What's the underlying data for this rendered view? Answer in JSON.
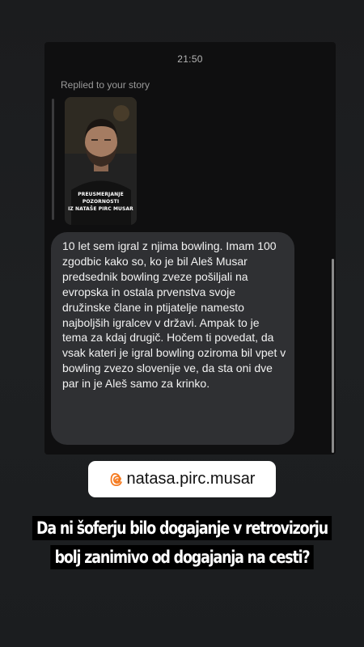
{
  "dm": {
    "time": "21:50",
    "replied_label": "Replied to your story",
    "story_caption_line1": "PREUSMERJANJE POZORNOSTI",
    "story_caption_line2": "IZ NATAŠE PIRC MUSAR",
    "message": "10 let sem igral z njima bowling. Imam 100 zgodbic kako so, ko je bil Aleš Musar predsednik bowling zveze pošiljali na evropska in ostala prvenstva svoje družinske člane in ptijatelje namesto najboljših igralcev v državi. Ampak to je tema za kdaj drugič. Hočem ti povedat, da vsak kateri je igral bowling oziroma bil vpet v bowling zvezo slovenije ve, da sta oni dve par in je Aleš samo za krinko."
  },
  "mention": {
    "icon": "threads-icon",
    "handle": "natasa.pirc.musar",
    "accent": "#f57a1f"
  },
  "headline": {
    "line1": "Da ni šoferju bilo dogajanje v retrovizorju",
    "line2": "bolj zanimivo od dogajanja na cesti?"
  },
  "colors": {
    "background": "#1c1d1f",
    "card": "#0f0f10",
    "bubble": "#2f3033",
    "headline_bg": "#000000"
  }
}
